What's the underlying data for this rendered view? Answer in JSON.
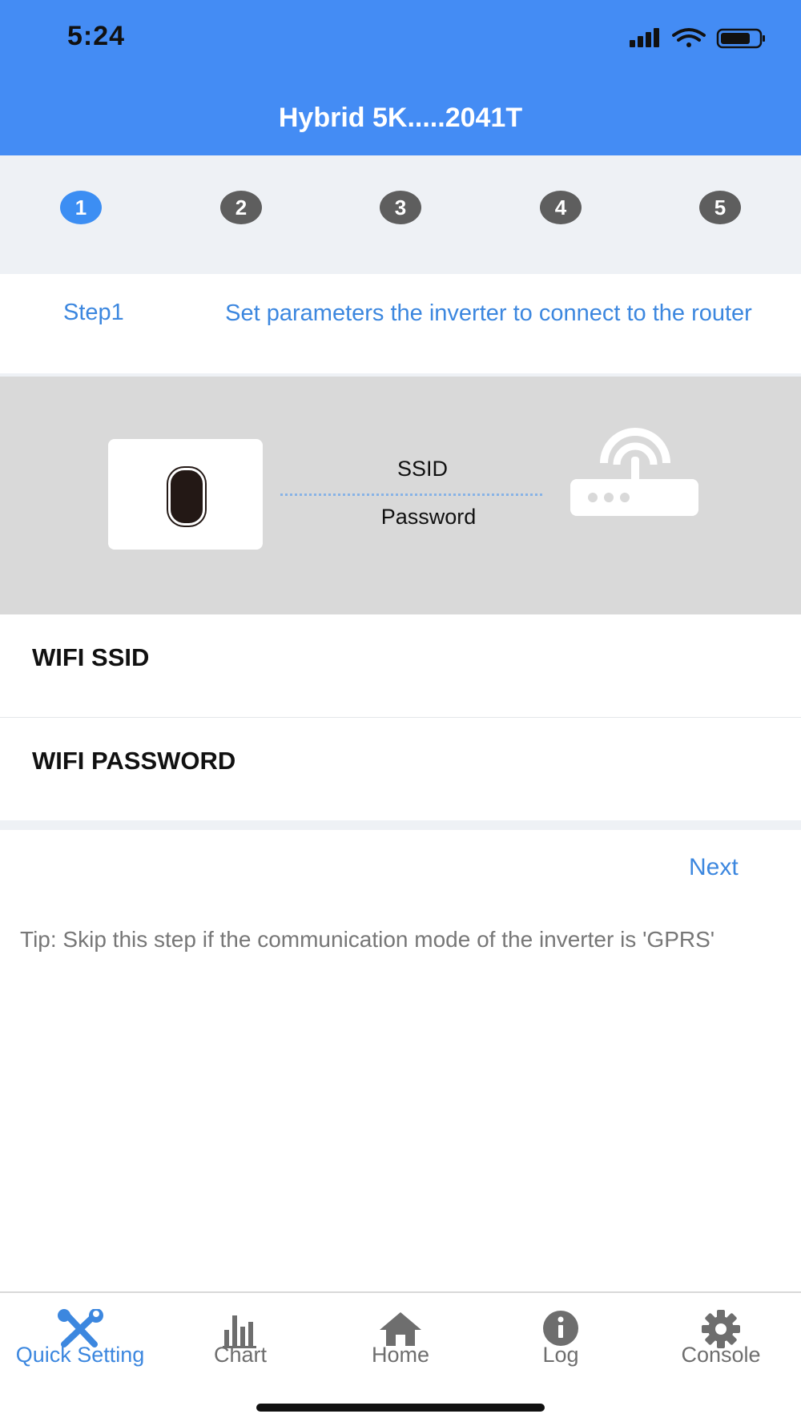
{
  "status_bar": {
    "time": "5:24",
    "icons": [
      "signal-icon",
      "wifi-icon",
      "battery-icon"
    ]
  },
  "header": {
    "title": "Hybrid 5K.....2041T"
  },
  "stepper": {
    "steps": [
      "1",
      "2",
      "3",
      "4",
      "5"
    ],
    "active_step": 1
  },
  "step_info": {
    "label": "Step1",
    "description": "Set parameters the inverter to connect to the router"
  },
  "illustration": {
    "ssid_label": "SSID",
    "password_label": "Password"
  },
  "form": {
    "ssid": {
      "label": "WIFI SSID",
      "value": "",
      "placeholder": ""
    },
    "password": {
      "label": "WIFI PASSWORD",
      "value": "",
      "placeholder": ""
    }
  },
  "actions": {
    "next_label": "Next"
  },
  "tip": "Tip: Skip this step if the communication mode of the inverter is 'GPRS'",
  "tabs": [
    {
      "label": "Quick Setting",
      "icon": "tools-icon",
      "active": true
    },
    {
      "label": "Chart",
      "icon": "bar-chart-icon",
      "active": false
    },
    {
      "label": "Home",
      "icon": "home-icon",
      "active": false
    },
    {
      "label": "Log",
      "icon": "info-icon",
      "active": false
    },
    {
      "label": "Console",
      "icon": "gear-icon",
      "active": false
    }
  ],
  "colors": {
    "header": "#448cf4",
    "accent": "#3c87df",
    "inactive_step": "#5e5e5e",
    "illustration_bg": "#d9d9d9"
  }
}
